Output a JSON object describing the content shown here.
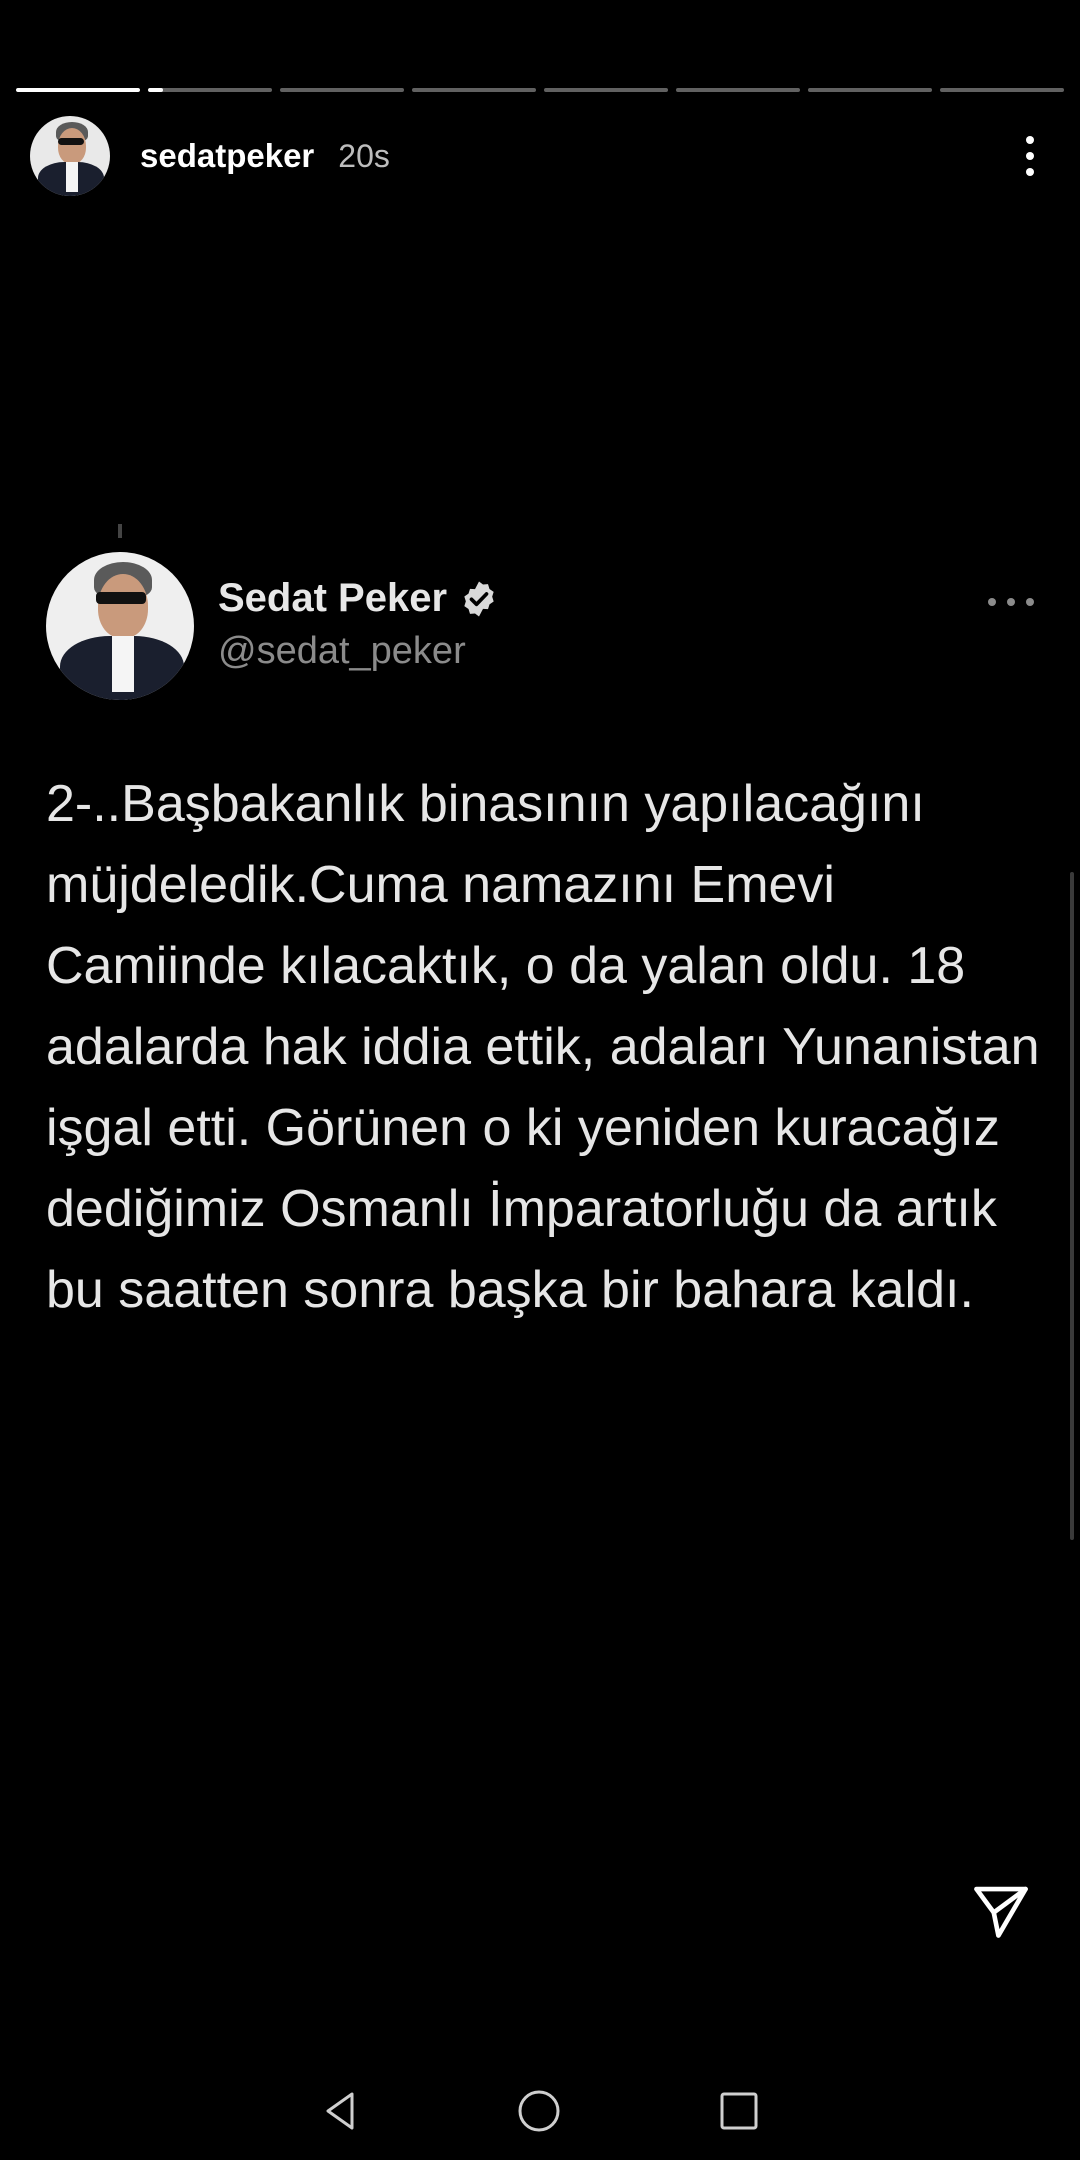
{
  "story": {
    "progress_segments": [
      1.0,
      0.12,
      0,
      0,
      0,
      0,
      0,
      0
    ],
    "username": "sedatpeker",
    "timestamp": "20s",
    "more_icon": "more-vertical-icon"
  },
  "tweet": {
    "display_name": "Sedat Peker",
    "verified_icon": "verified-badge-icon",
    "handle": "@sedat_peker",
    "more_icon": "more-horizontal-icon",
    "text": "2-..Başbakanlık binasının yapılacağını müjdeledik.Cuma namazını Emevi Camiinde kılacaktık, o da yalan oldu. 18 adalarda hak iddia ettik, adaları Yunanistan işgal etti. Görünen o ki yeniden kuracağız dediğimiz Osmanlı İmparatorluğu da artık bu saatten sonra başka bir bahara kaldı."
  },
  "actions": {
    "send_icon": "send-icon"
  },
  "system_nav": {
    "back_icon": "back-triangle-icon",
    "home_icon": "home-circle-icon",
    "recents_icon": "recents-square-icon"
  },
  "colors": {
    "background": "#000000",
    "text_primary": "#e6e6e6",
    "text_secondary": "#8b8b8b",
    "progress_inactive": "#616161",
    "progress_active": "#ffffff"
  }
}
